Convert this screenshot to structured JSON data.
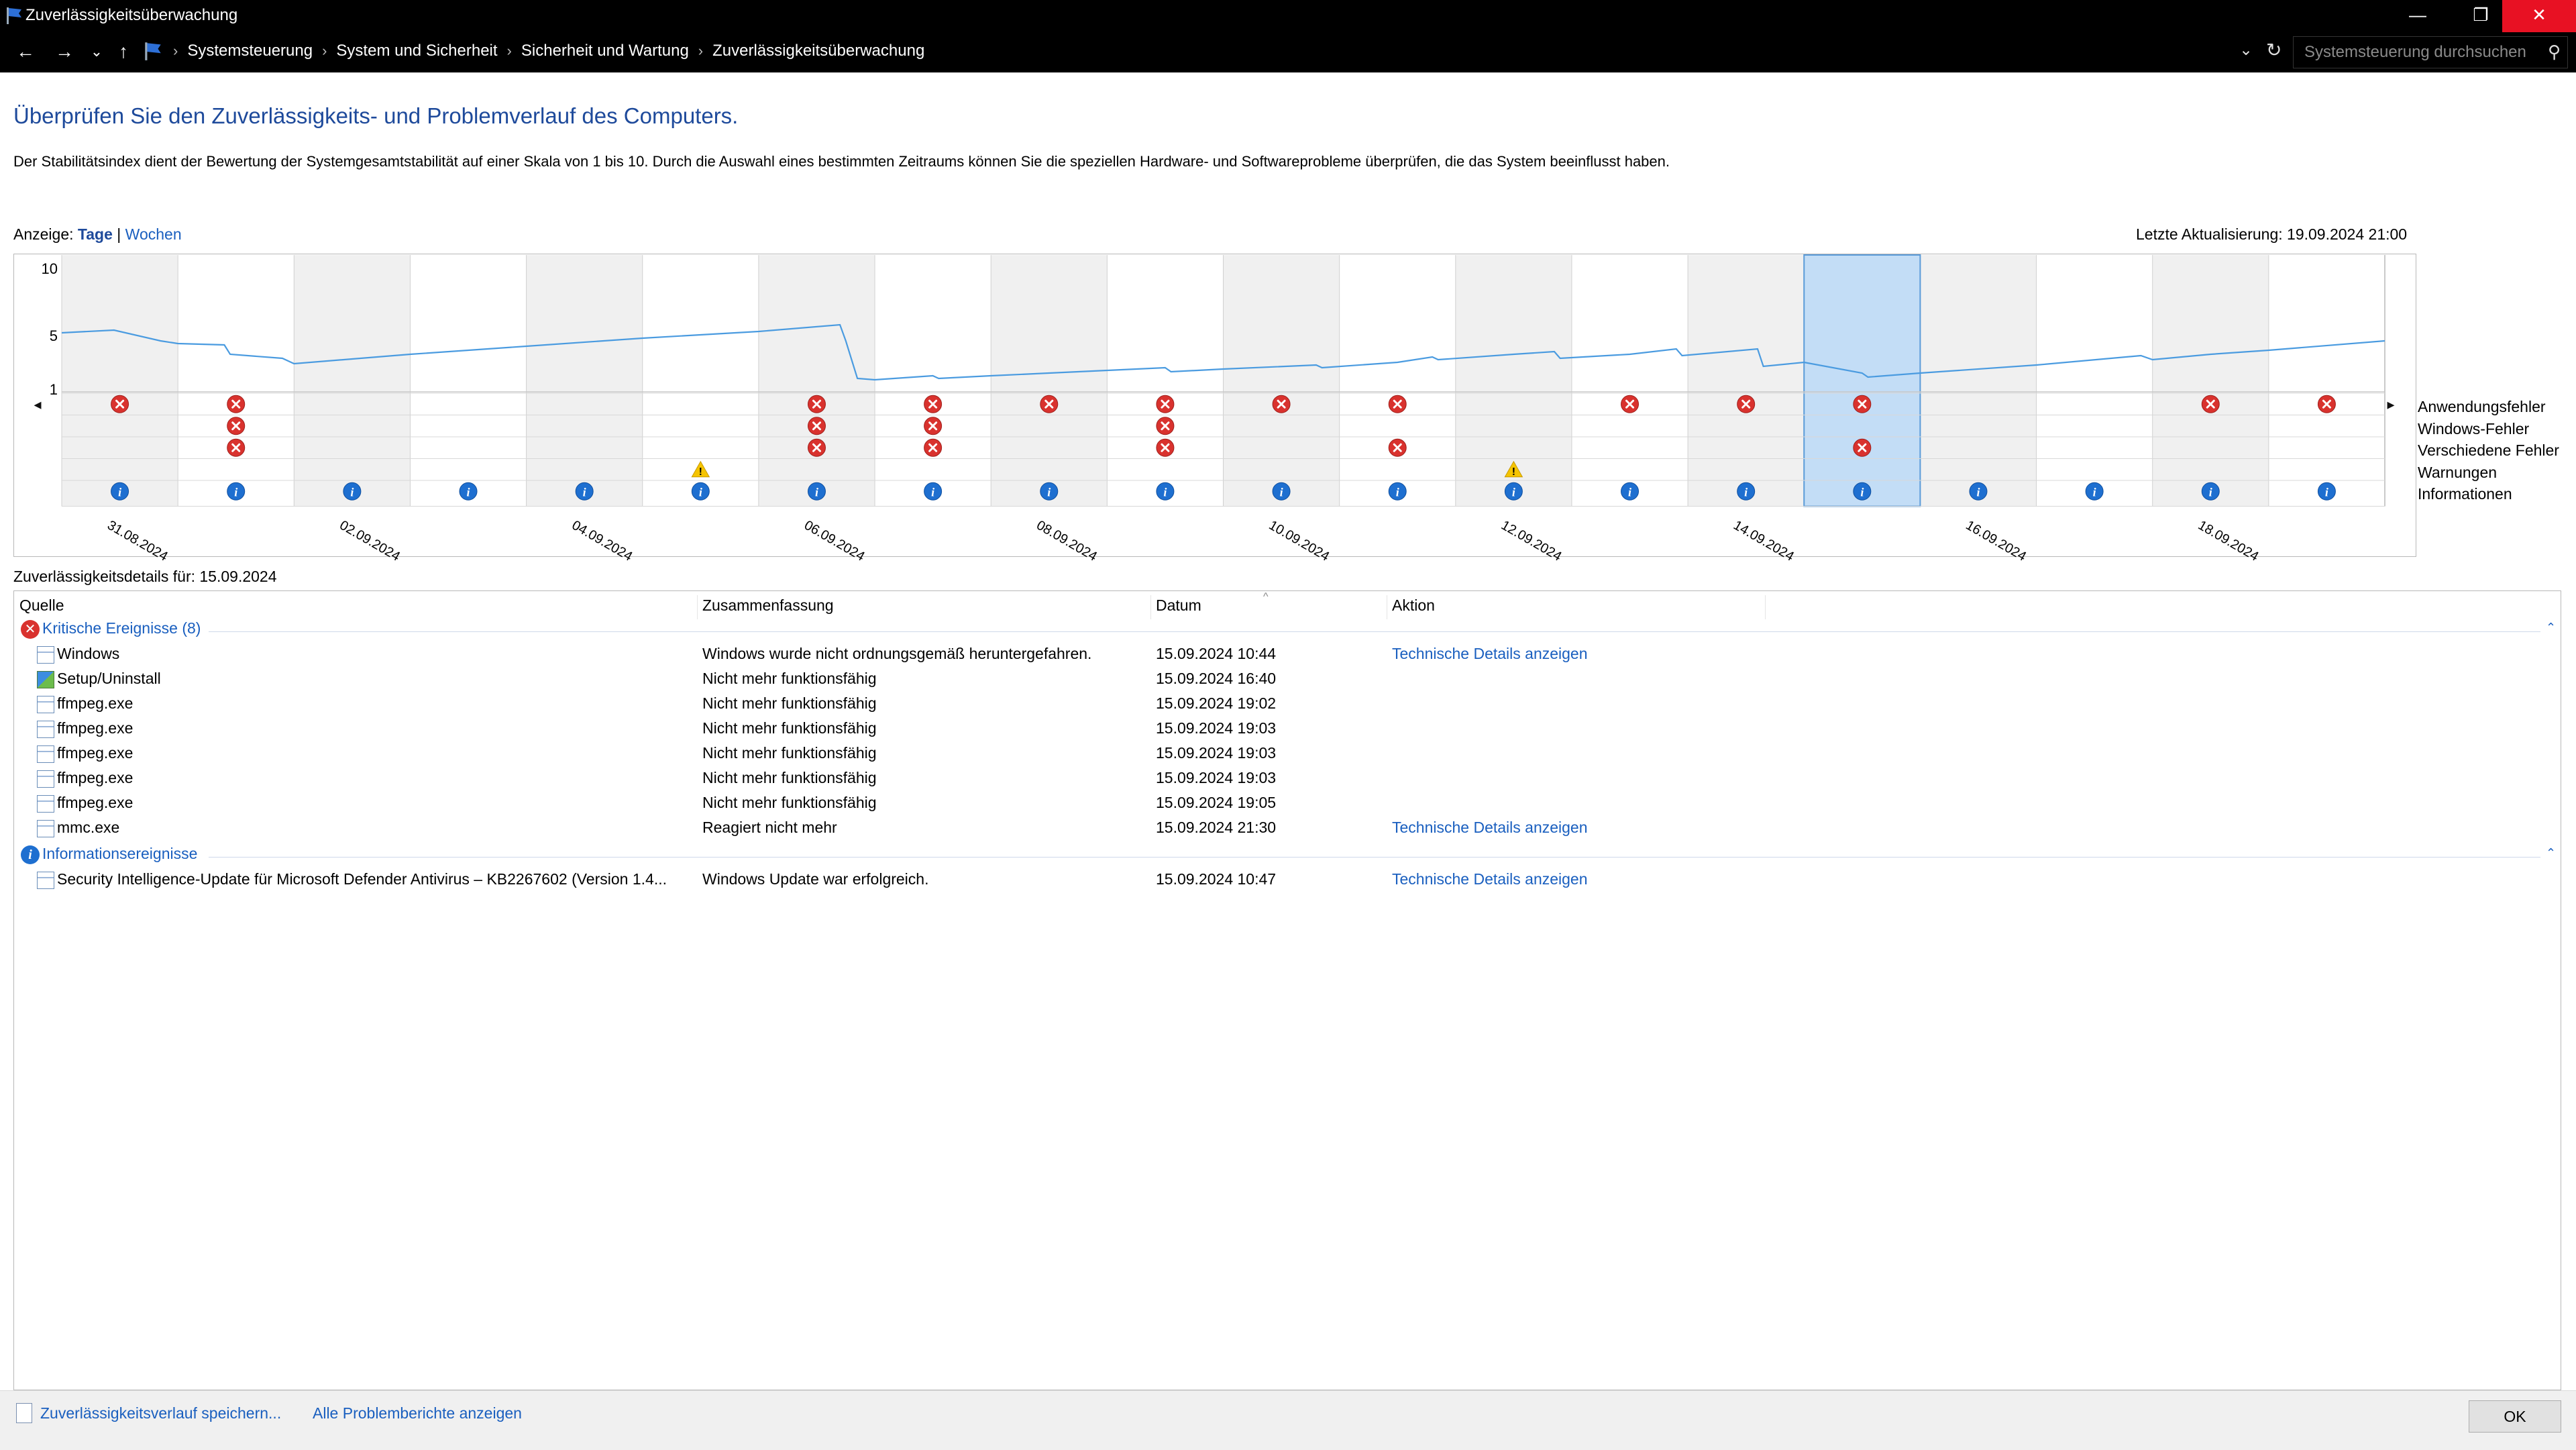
{
  "window": {
    "title": "Zuverlässigkeitsüberwachung",
    "min": "—",
    "max": "❐",
    "close": "✕"
  },
  "nav": {
    "back": "←",
    "forward": "→",
    "history": "⌄",
    "up": "↑"
  },
  "address": {
    "crumbs": [
      "Systemsteuerung",
      "System und Sicherheit",
      "Sicherheit und Wartung",
      "Zuverlässigkeitsüberwachung"
    ],
    "search_placeholder": "Systemsteuerung durchsuchen"
  },
  "header": {
    "heading": "Überprüfen Sie den Zuverlässigkeits- und Problemverlauf des Computers.",
    "description": "Der Stabilitätsindex dient der Bewertung der Systemgesamtstabilität auf einer Skala von 1 bis 10. Durch die Auswahl eines bestimmten Zeitraums können Sie die speziellen Hardware- und Softwareprobleme überprüfen, die das System beeinflusst haben.",
    "view_label": "Anzeige:",
    "view_days": "Tage",
    "view_sep": "|",
    "view_weeks": "Wochen",
    "last_update": "Letzte Aktualisierung: 19.09.2024 21:00"
  },
  "chart_data": {
    "type": "line",
    "y_ticks": [
      "10",
      "5",
      "1"
    ],
    "days": [
      "31.08.2024",
      "01.09.2024",
      "02.09.2024",
      "03.09.2024",
      "04.09.2024",
      "05.09.2024",
      "06.09.2024",
      "07.09.2024",
      "08.09.2024",
      "09.09.2024",
      "10.09.2024",
      "11.09.2024",
      "12.09.2024",
      "13.09.2024",
      "14.09.2024",
      "15.09.2024",
      "16.09.2024",
      "17.09.2024",
      "18.09.2024",
      "19.09.2024"
    ],
    "x_labels": [
      "31.08.2024",
      "",
      "02.09.2024",
      "",
      "04.09.2024",
      "",
      "06.09.2024",
      "",
      "08.09.2024",
      "",
      "10.09.2024",
      "",
      "12.09.2024",
      "",
      "14.09.2024",
      "",
      "16.09.2024",
      "",
      "18.09.2024",
      ""
    ],
    "selected_day": "15.09.2024",
    "stability": [
      [
        0.0,
        5.2
      ],
      [
        0.45,
        5.4
      ],
      [
        0.85,
        4.6
      ],
      [
        1.0,
        4.4
      ],
      [
        1.4,
        4.3
      ],
      [
        1.45,
        3.6
      ],
      [
        1.9,
        3.3
      ],
      [
        2.0,
        2.9
      ],
      [
        3.0,
        3.6
      ],
      [
        4.0,
        4.2
      ],
      [
        5.0,
        4.8
      ],
      [
        6.0,
        5.3
      ],
      [
        6.7,
        5.8
      ],
      [
        6.75,
        4.6
      ],
      [
        6.85,
        1.8
      ],
      [
        7.0,
        1.7
      ],
      [
        7.5,
        2.0
      ],
      [
        7.55,
        1.8
      ],
      [
        8.0,
        2.0
      ],
      [
        8.5,
        2.2
      ],
      [
        9.0,
        2.4
      ],
      [
        9.5,
        2.6
      ],
      [
        9.55,
        2.3
      ],
      [
        10.0,
        2.5
      ],
      [
        10.8,
        2.8
      ],
      [
        10.85,
        2.6
      ],
      [
        11.5,
        3.0
      ],
      [
        11.8,
        3.4
      ],
      [
        11.85,
        3.2
      ],
      [
        12.5,
        3.6
      ],
      [
        12.85,
        3.8
      ],
      [
        12.9,
        3.3
      ],
      [
        13.5,
        3.6
      ],
      [
        13.9,
        4.0
      ],
      [
        13.95,
        3.5
      ],
      [
        14.6,
        4.0
      ],
      [
        14.65,
        2.7
      ],
      [
        15.0,
        3.0
      ],
      [
        15.5,
        2.2
      ],
      [
        15.55,
        1.9
      ],
      [
        16.0,
        2.2
      ],
      [
        17.0,
        2.8
      ],
      [
        17.9,
        3.5
      ],
      [
        18.0,
        3.2
      ],
      [
        18.5,
        3.6
      ],
      [
        19.0,
        3.9
      ],
      [
        20.0,
        4.6
      ]
    ],
    "row_labels": [
      "Anwendungsfehler",
      "Windows-Fehler",
      "Verschiedene Fehler",
      "Warnungen",
      "Informationen"
    ],
    "events": {
      "Anwendungsfehler": [
        1,
        1,
        0,
        0,
        0,
        0,
        1,
        1,
        1,
        1,
        1,
        1,
        0,
        1,
        1,
        1,
        0,
        0,
        1,
        1
      ],
      "Windows-Fehler": [
        0,
        1,
        0,
        0,
        0,
        0,
        1,
        1,
        0,
        1,
        0,
        0,
        0,
        0,
        0,
        0,
        0,
        0,
        0,
        0
      ],
      "Verschiedene Fehler": [
        0,
        1,
        0,
        0,
        0,
        0,
        1,
        1,
        0,
        1,
        0,
        1,
        0,
        0,
        0,
        1,
        0,
        0,
        0,
        0
      ],
      "Warnungen": [
        0,
        0,
        0,
        0,
        0,
        1,
        0,
        0,
        0,
        0,
        0,
        0,
        1,
        0,
        0,
        0,
        0,
        0,
        0,
        0
      ],
      "Informationen": [
        1,
        1,
        1,
        1,
        1,
        1,
        1,
        1,
        1,
        1,
        1,
        1,
        1,
        1,
        1,
        1,
        1,
        1,
        1,
        1
      ]
    },
    "colors": {
      "line": "#4a9be0",
      "selected": "#c3ddf6",
      "error": "#d9322e",
      "info": "#1e6fd0",
      "warning": "#f5c400",
      "shade": "#f0f0f0"
    }
  },
  "details": {
    "header": "Zuverlässigkeitsdetails für: 15.09.2024",
    "columns": [
      "Quelle",
      "Zusammenfassung",
      "Datum",
      "Aktion"
    ],
    "critical_group": "Kritische Ereignisse (8)",
    "critical_rows": [
      {
        "source": "Windows",
        "summary": "Windows wurde nicht ordnungsgemäß heruntergefahren.",
        "date": "15.09.2024 10:44",
        "action": "Technische Details anzeigen",
        "icon": "app"
      },
      {
        "source": "Setup/Uninstall",
        "summary": "Nicht mehr funktionsfähig",
        "date": "15.09.2024 16:40",
        "action": "",
        "icon": "setup"
      },
      {
        "source": "ffmpeg.exe",
        "summary": "Nicht mehr funktionsfähig",
        "date": "15.09.2024 19:02",
        "action": "",
        "icon": "app"
      },
      {
        "source": "ffmpeg.exe",
        "summary": "Nicht mehr funktionsfähig",
        "date": "15.09.2024 19:03",
        "action": "",
        "icon": "app"
      },
      {
        "source": "ffmpeg.exe",
        "summary": "Nicht mehr funktionsfähig",
        "date": "15.09.2024 19:03",
        "action": "",
        "icon": "app"
      },
      {
        "source": "ffmpeg.exe",
        "summary": "Nicht mehr funktionsfähig",
        "date": "15.09.2024 19:03",
        "action": "",
        "icon": "app"
      },
      {
        "source": "ffmpeg.exe",
        "summary": "Nicht mehr funktionsfähig",
        "date": "15.09.2024 19:05",
        "action": "",
        "icon": "app"
      },
      {
        "source": "mmc.exe",
        "summary": "Reagiert nicht mehr",
        "date": "15.09.2024 21:30",
        "action": "Technische Details anzeigen",
        "icon": "app"
      }
    ],
    "info_group": "Informationsereignisse",
    "info_rows": [
      {
        "source": "Security Intelligence-Update für Microsoft Defender Antivirus – KB2267602 (Version 1.4...",
        "summary": "Windows Update war erfolgreich.",
        "date": "15.09.2024 10:47",
        "action": "Technische Details anzeigen",
        "icon": "app"
      }
    ]
  },
  "footer": {
    "save_link": "Zuverlässigkeitsverlauf speichern...",
    "reports_link": "Alle Problemberichte anzeigen",
    "ok": "OK"
  }
}
